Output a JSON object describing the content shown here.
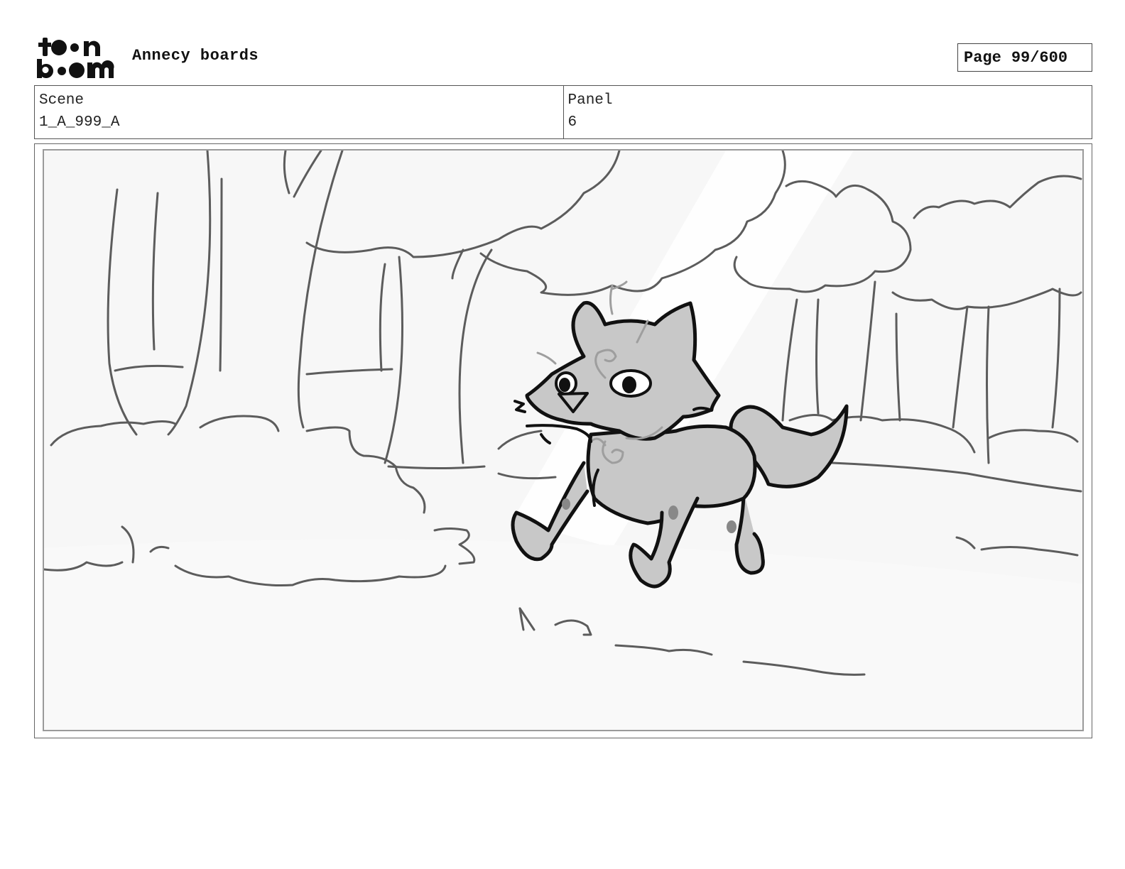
{
  "header": {
    "logo_text_top": "toon",
    "logo_text_bottom": "boom",
    "project_title": "Annecy boards",
    "page_label": "Page",
    "page_value": "99/600"
  },
  "info": {
    "scene_label": "Scene",
    "scene_value": "1_A_999_A",
    "panel_label": "Panel",
    "panel_value": "6"
  },
  "colors": {
    "ink": "#111111",
    "line_gray": "#5c5c5c",
    "fox_fill": "#c8c8c8",
    "paper": "#f7f7f7"
  }
}
